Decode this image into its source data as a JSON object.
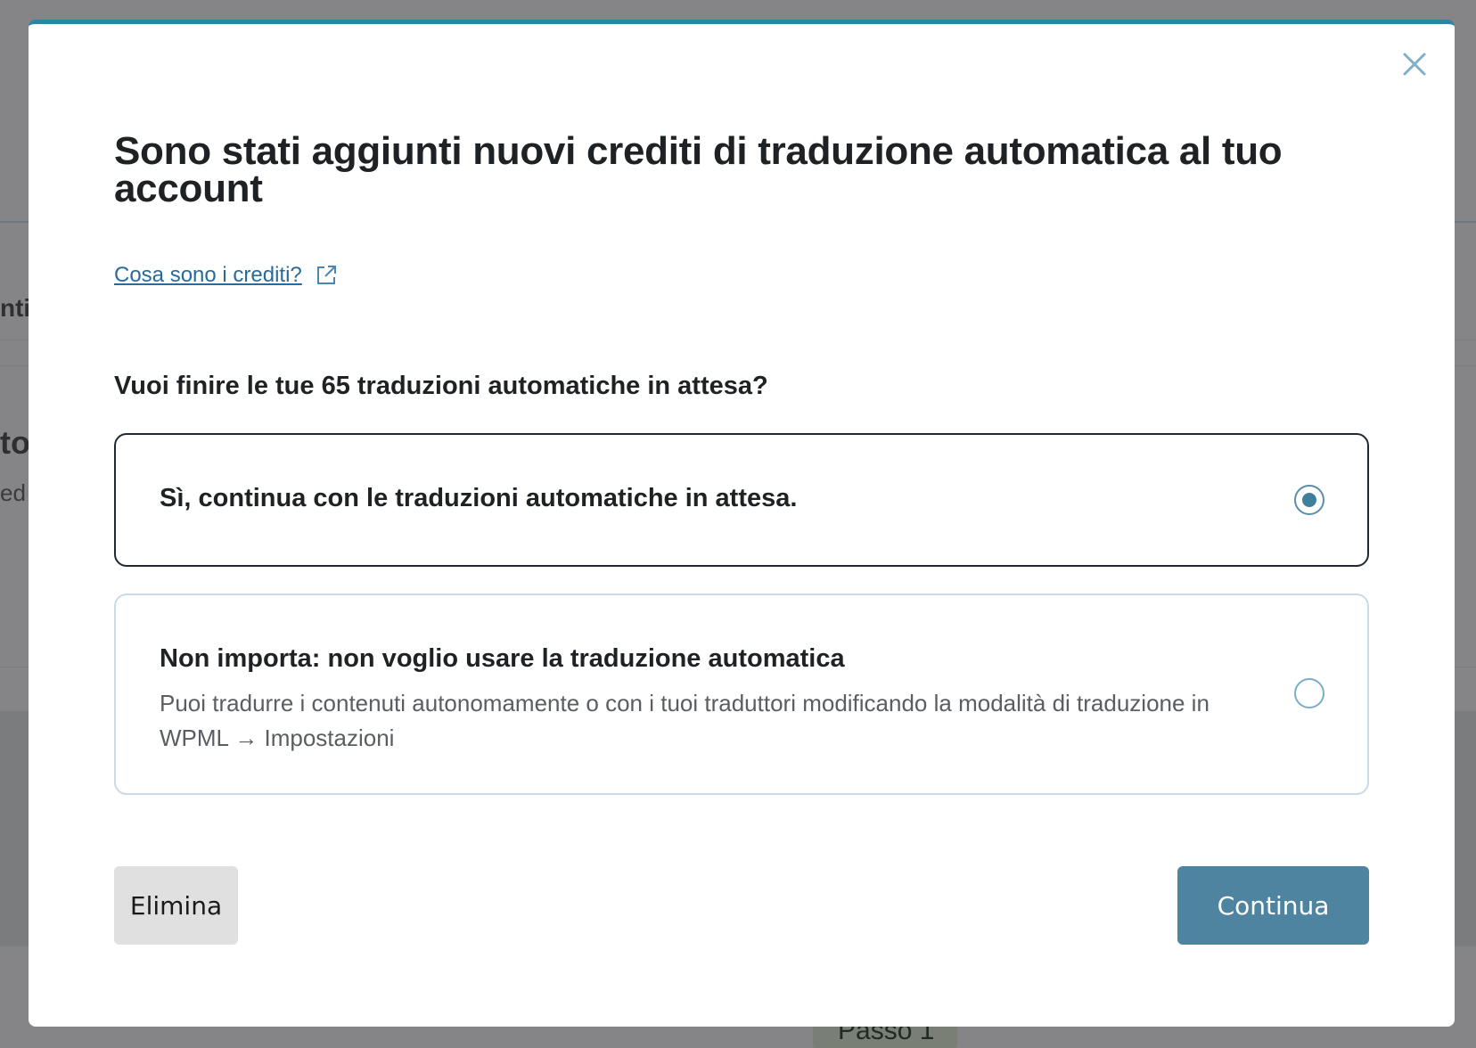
{
  "background": {
    "partial_text_1": "nti",
    "partial_text_2": "to",
    "partial_text_3": "ed",
    "step_label": "Passo 1"
  },
  "modal": {
    "title": "Sono stati aggiunti nuovi crediti di traduzione automatica al tuo account",
    "help_link": "Cosa sono i crediti?",
    "question": "Vuoi finire le tue 65 traduzioni automatiche in attesa?",
    "options": [
      {
        "label": "Sì, continua con le traduzioni automatiche in attesa.",
        "selected": true
      },
      {
        "label": "Non importa: non voglio usare la traduzione automatica",
        "description": "Puoi tradurre i contenuti autonomamente o con i tuoi traduttori modificando la modalità di traduzione in WPML → Impostazioni",
        "selected": false
      }
    ],
    "buttons": {
      "delete": "Elimina",
      "continue": "Continua"
    }
  },
  "colors": {
    "accent": "#2a86a8",
    "primary_button": "#4f84a0",
    "link": "#2a6a9a",
    "overlay": "#858587"
  },
  "icons": {
    "close": "close-icon",
    "external_link": "external-link-icon"
  }
}
